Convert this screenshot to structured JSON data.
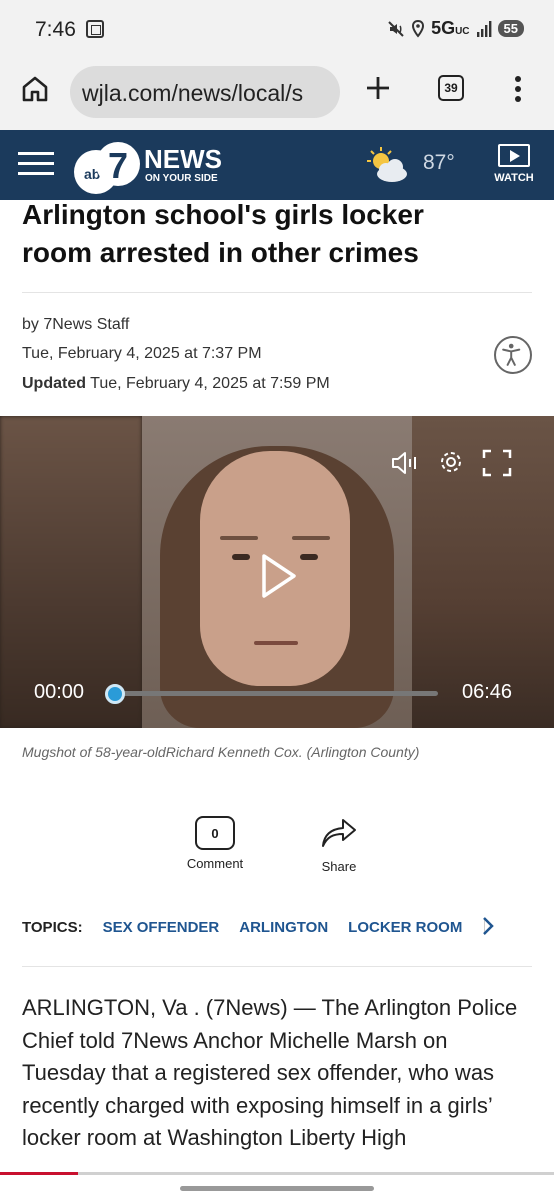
{
  "status_bar": {
    "time": "7:46",
    "network": "5G",
    "network_sub": "UC",
    "battery": "55"
  },
  "browser": {
    "url": "wjla.com/news/local/s",
    "tab_count": "39"
  },
  "site_header": {
    "logo_text": "NEWS",
    "logo_tagline": "ON YOUR SIDE",
    "logo_channel": "7",
    "logo_network": "abc",
    "temperature": "87°",
    "watch_label": "WATCH"
  },
  "article": {
    "headline_line1": "Arlington school's girls locker",
    "headline_line2": "room arrested in other crimes",
    "byline": "by 7News Staff",
    "published": "Tue, February 4, 2025 at 7:37 PM",
    "updated_label": "Updated",
    "updated_date": "Tue, February 4, 2025 at 7:59 PM",
    "caption": "Mugshot of 58-year-oldRichard Kenneth Cox. (Arlington County)"
  },
  "video": {
    "current_time": "00:00",
    "duration": "06:46",
    "progress": 0.01
  },
  "actions": {
    "comment_count": "0",
    "comment_label": "Comment",
    "share_label": "Share"
  },
  "topics": {
    "label": "TOPICS:",
    "tags": [
      "SEX OFFENDER",
      "ARLINGTON",
      "LOCKER ROOM"
    ]
  },
  "body": {
    "paragraph": "ARLINGTON, Va . (7News) — The Arlington Police Chief told 7News Anchor Michelle Marsh on Tuesday that a registered sex offender, who was recently charged with exposing himself in a girls’ locker room at Washington Liberty High"
  },
  "colors": {
    "header_bg": "#1b3a5c",
    "topic_link": "#1f5590",
    "video_progress": "#2a9bd8"
  }
}
